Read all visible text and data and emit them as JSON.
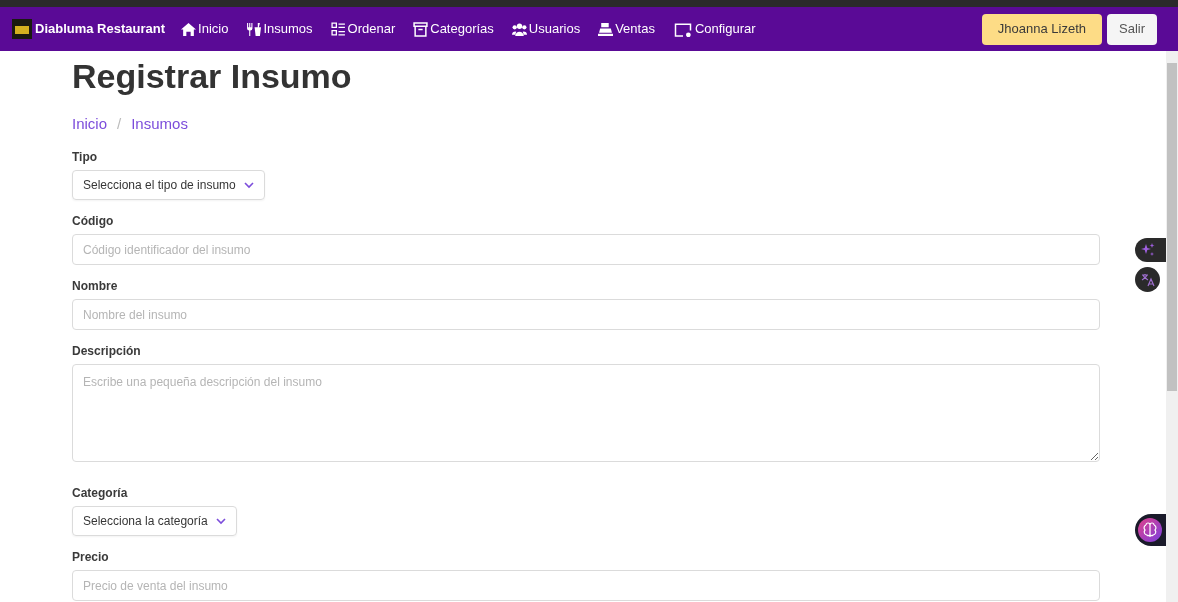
{
  "navbar": {
    "brand": "Diabluma Restaurant",
    "links": [
      {
        "label": "Inicio"
      },
      {
        "label": "Insumos"
      },
      {
        "label": "Ordenar"
      },
      {
        "label": "Categorías"
      },
      {
        "label": "Usuarios"
      },
      {
        "label": "Ventas"
      },
      {
        "label": "Configurar"
      }
    ],
    "user_button": "Jhoanna Lizeth",
    "logout_button": "Salir"
  },
  "page_title": "Registrar Insumo",
  "breadcrumb": {
    "separator": "/",
    "items": [
      "Inicio",
      "Insumos"
    ]
  },
  "form": [
    {
      "kind": "select",
      "label": "Tipo",
      "placeholder": "Selecciona el tipo de insumo"
    },
    {
      "kind": "input",
      "label": "Código",
      "placeholder": "Código identificador del insumo"
    },
    {
      "kind": "input",
      "label": "Nombre",
      "placeholder": "Nombre del insumo"
    },
    {
      "kind": "textarea",
      "label": "Descripción",
      "placeholder": "Escribe una pequeña descripción del insumo"
    },
    {
      "kind": "select",
      "label": "Categoría",
      "placeholder": "Selecciona la categoría"
    },
    {
      "kind": "input",
      "label": "Precio",
      "placeholder": "Precio de venta del insumo"
    }
  ]
}
